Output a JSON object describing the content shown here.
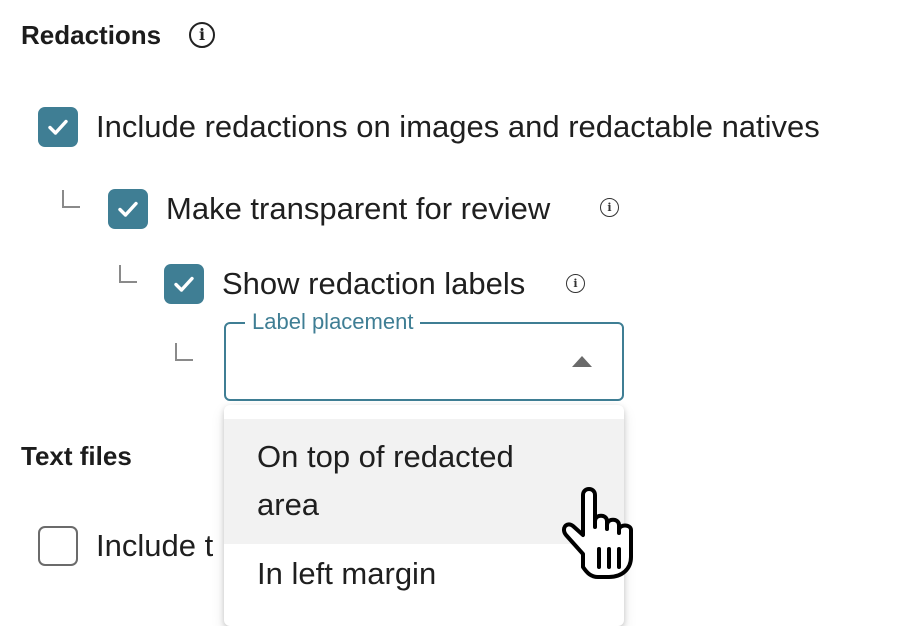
{
  "redactions": {
    "title": "Redactions",
    "title_info_icon": "info-icon",
    "include_redactions": {
      "label": "Include redactions on images and redactable natives",
      "checked": true
    },
    "make_transparent": {
      "label": "Make transparent for review",
      "checked": true,
      "info_icon": "info-icon"
    },
    "show_labels": {
      "label": "Show redaction labels",
      "checked": true,
      "info_icon": "info-icon"
    },
    "label_placement": {
      "legend": "Label placement",
      "value": "",
      "expanded": true,
      "caret_icon": "caret-up-icon",
      "options": [
        {
          "label": "On top of redacted area",
          "hovered": true
        },
        {
          "label": "In left margin",
          "hovered": false
        }
      ]
    }
  },
  "text_files": {
    "title": "Text files",
    "include_option": {
      "label": "Include t",
      "checked": false
    }
  },
  "cursor": {
    "icon": "hand-pointer-cursor-icon"
  },
  "colors": {
    "accent": "#3f7e94",
    "text": "#1f1f1f",
    "connector": "#8a8a8a",
    "hover": "#f2f2f2"
  }
}
